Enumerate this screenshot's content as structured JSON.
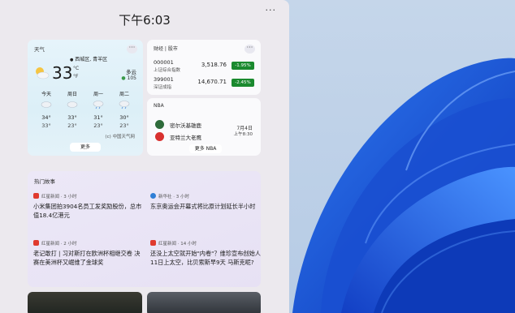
{
  "panel": {
    "time": "下午6:03",
    "more": "···"
  },
  "weather": {
    "title": "天气",
    "location": "西城区, 青羊区",
    "temperature": "33",
    "unit_c": "°C",
    "unit_f": "°F",
    "condition": "多云",
    "aqi": "105",
    "forecast": [
      {
        "day": "今天",
        "hi": "34°",
        "lo": "33°",
        "icon": "cloudy-icon"
      },
      {
        "day": "周日",
        "hi": "33°",
        "lo": "23°",
        "icon": "cloudy-icon"
      },
      {
        "day": "周一",
        "hi": "31°",
        "lo": "23°",
        "icon": "rain-icon"
      },
      {
        "day": "周二",
        "hi": "30°",
        "lo": "23°",
        "icon": "rain-icon"
      }
    ],
    "source": "(c) 中国天气网",
    "more": "更多"
  },
  "stocks": {
    "title": "财经 | 股市",
    "items": [
      {
        "code": "000001",
        "name": "上证综合指数",
        "value": "3,518.76",
        "change": "-1.95%"
      },
      {
        "code": "399001",
        "name": "深证成指",
        "value": "14,670.71",
        "change": "-2.45%"
      }
    ]
  },
  "nba": {
    "title": "NBA",
    "team1": "密尔沃基雄鹿",
    "team2": "亚特兰大老鹰",
    "date": "7月4日",
    "time": "上午8:30",
    "more": "更多 NBA"
  },
  "news": {
    "title": "热门故事",
    "items": [
      {
        "source": "红星新闻 · 3 小时",
        "headline": "小米集团拍3904名员工发奖励股份，总市值18.4亿港元",
        "icon_color": "#e03a2f"
      },
      {
        "source": "新华社 · 3 小时",
        "headline": "东京奥运会开幕式将比原计划延长半小时",
        "icon_color": "#2f7fd6"
      },
      {
        "source": "红星新闻 · 2 小时",
        "headline": "老记敢打 | 习对斯打在欧洲杯相继交卷 决赛在美洲杯又崛维了金球奖",
        "icon_color": "#e03a2f"
      },
      {
        "source": "红星新闻 · 14 小时",
        "headline": "还没上太空就开始\"内卷\"？维珍宣布创始人11日上太空，比贝索斯早9天 马斯克呢?",
        "icon_color": "#e03a2f"
      }
    ]
  },
  "colors": {
    "panel_bg": "#ece9ee",
    "stock_down_badge": "#1a8a2e",
    "wallpaper_blue": "#1a55d6"
  }
}
